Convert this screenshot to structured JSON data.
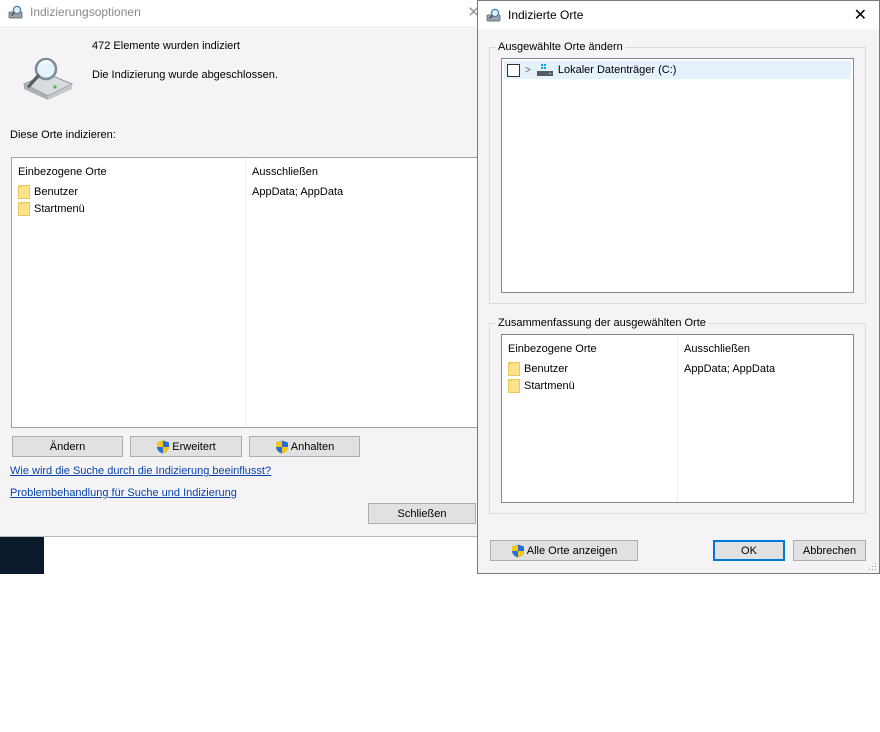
{
  "indexing_options": {
    "window_title": "Indizierungsoptionen",
    "items_indexed": "472 Elemente wurden indiziert",
    "status": "Die Indizierung wurde abgeschlossen.",
    "section_label": "Diese Orte indizieren:",
    "table": {
      "col_included": "Einbezogene Orte",
      "col_exclude": "Ausschließen",
      "rows": [
        {
          "location": "Benutzer",
          "exclude": "AppData; AppData"
        },
        {
          "location": "Startmenü",
          "exclude": ""
        }
      ]
    },
    "buttons": {
      "modify": "Ändern",
      "advanced": "Erweitert",
      "pause": "Anhalten",
      "close": "Schließen"
    },
    "links": {
      "how_indexing_affects": "Wie wird die Suche durch die Indizierung beeinflusst?",
      "troubleshoot": "Problembehandlung für Suche und Indizierung"
    }
  },
  "indexed_locations": {
    "window_title": "Indizierte Orte",
    "change_group_title": "Ausgewählte Orte ändern",
    "tree": [
      {
        "label": "Lokaler Datenträger (C:)",
        "checked": false
      }
    ],
    "summary_group_title": "Zusammenfassung der ausgewählten Orte",
    "summary_table": {
      "col_included": "Einbezogene Orte",
      "col_exclude": "Ausschließen",
      "rows": [
        {
          "location": "Benutzer",
          "exclude": "AppData; AppData"
        },
        {
          "location": "Startmenü",
          "exclude": ""
        }
      ]
    },
    "buttons": {
      "show_all": "Alle Orte anzeigen",
      "ok": "OK",
      "cancel": "Abbrechen"
    }
  },
  "colors": {
    "dialog_bg": "#f6f3f6",
    "link": "#0645ad",
    "selection": "#e5f1fb",
    "ok_border": "#0078d7",
    "folder": "#fce28a"
  }
}
